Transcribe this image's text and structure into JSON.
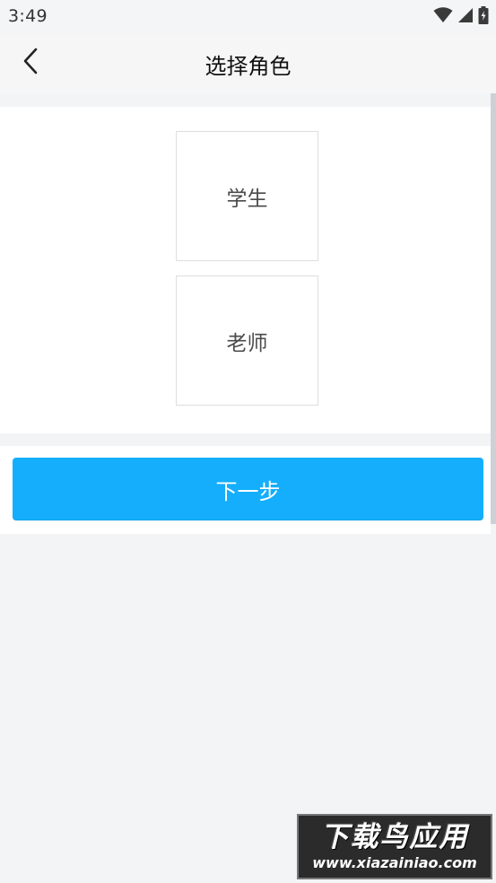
{
  "status_bar": {
    "time": "3:49",
    "icons": [
      "wifi-icon",
      "signal-icon",
      "battery-charging-icon"
    ]
  },
  "header": {
    "title": "选择角色",
    "back_icon": "chevron-left-icon"
  },
  "roles": [
    {
      "label": "学生"
    },
    {
      "label": "老师"
    }
  ],
  "actions": {
    "next_label": "下一步"
  },
  "watermark": {
    "title": "下载鸟应用",
    "url": "www.xiazainiao.com"
  },
  "colors": {
    "accent": "#14aefc",
    "background": "#f3f4f6",
    "card_border": "#dedede"
  }
}
